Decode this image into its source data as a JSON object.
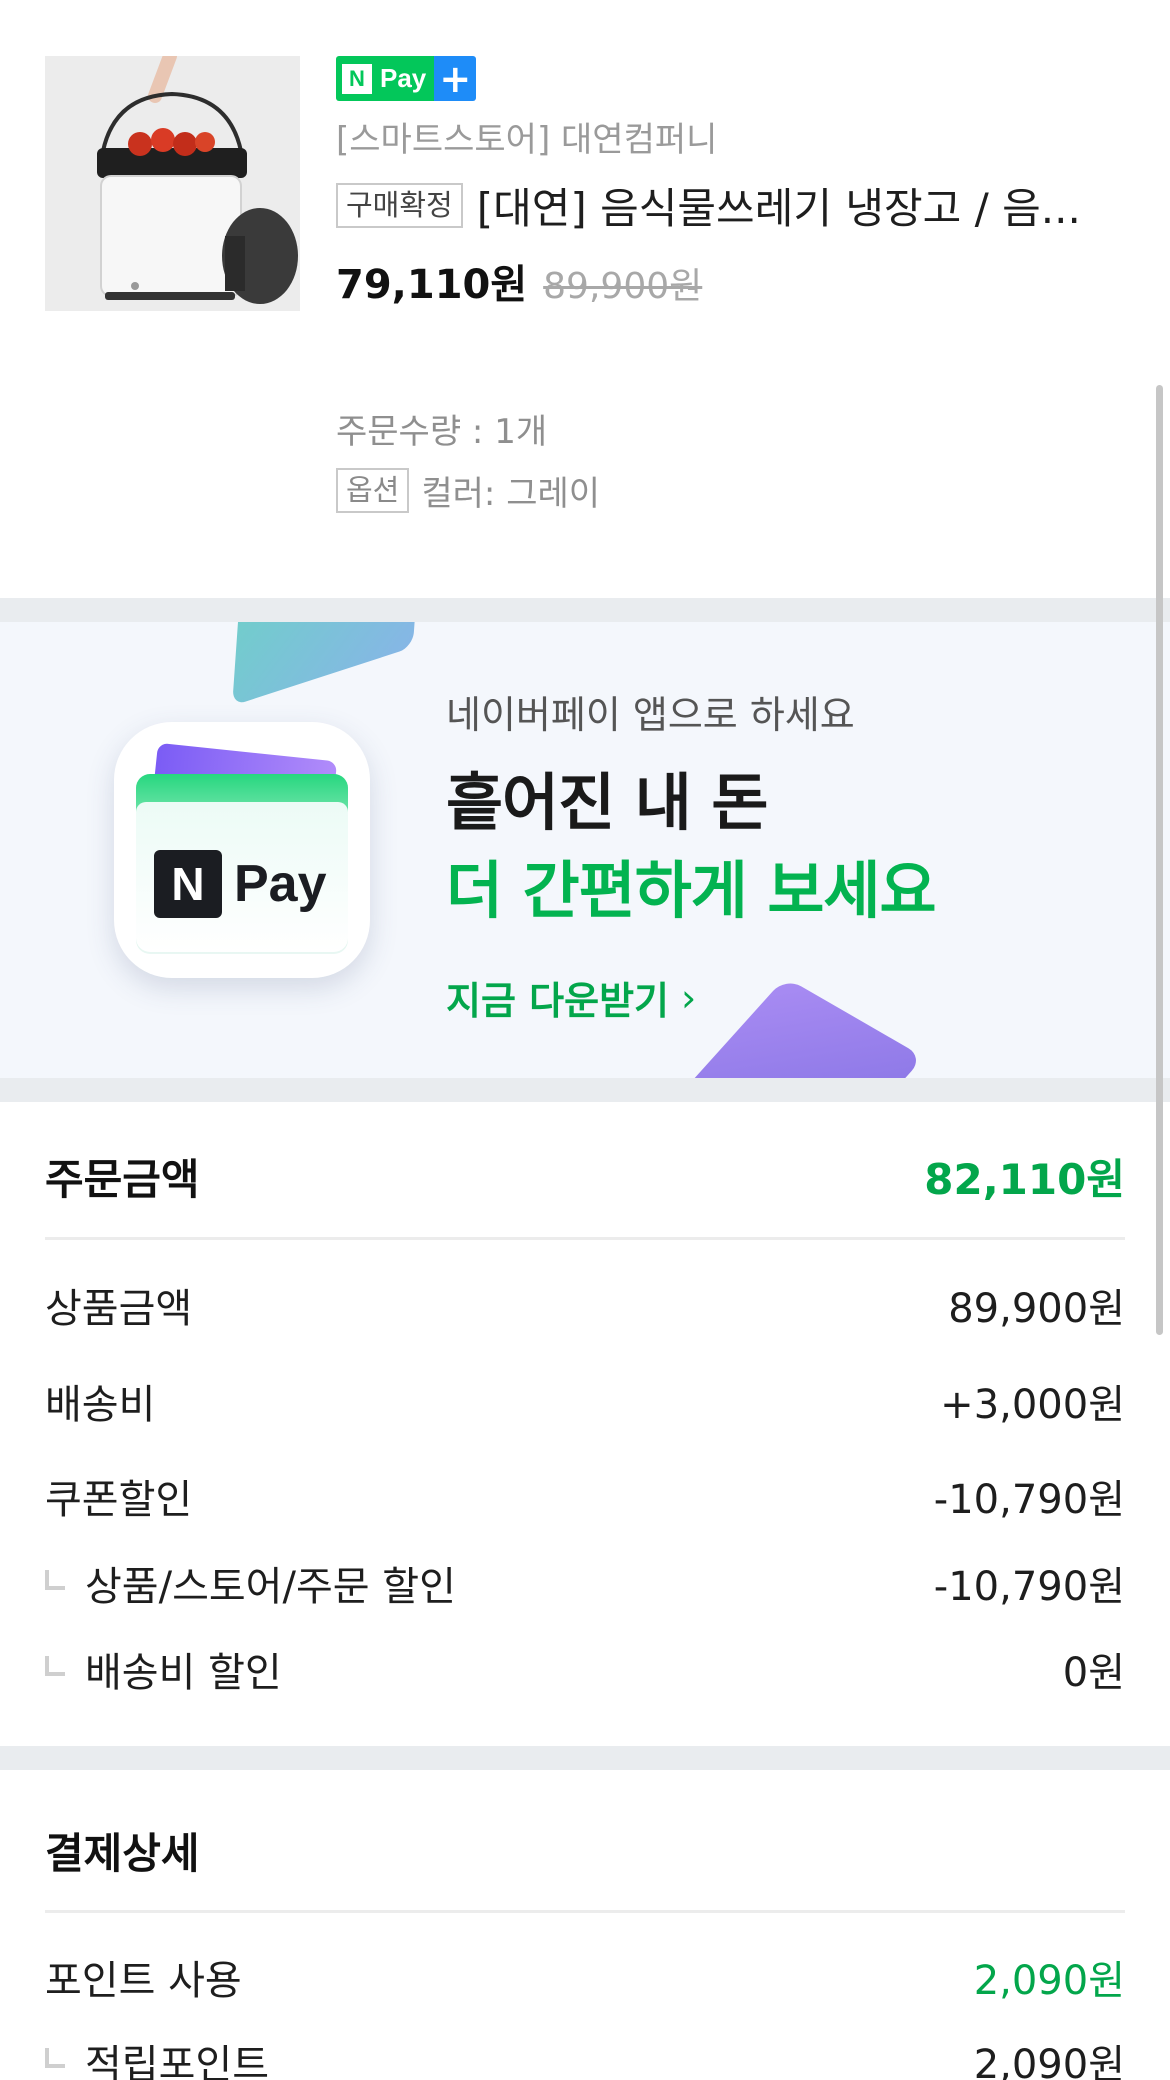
{
  "product": {
    "badge": {
      "n": "N",
      "pay": "Pay",
      "plus": "+"
    },
    "store": "[스마트스토어] 대연컴퍼니",
    "status": "구매확정",
    "title": "[대연] 음식물쓰레기 냉장고 / 음...",
    "price": "79,110원",
    "original_price": "89,900원",
    "quantity": "주문수량 : 1개",
    "option_tag": "옵션",
    "option_value": "컬러: 그레이"
  },
  "banner": {
    "subtitle": "네이버페이 앱으로 하세요",
    "line1": "흩어진 내 돈",
    "line2": "더 간편하게 보세요",
    "cta": "지금 다운받기",
    "cta_chevron": "›",
    "icon_n": "N",
    "icon_pay": "Pay"
  },
  "order_summary": {
    "title": "주문금액",
    "total": "82,110원",
    "rows": [
      {
        "label": "상품금액",
        "value": "89,900원"
      },
      {
        "label": "배송비",
        "value": "+3,000원"
      },
      {
        "label": "쿠폰할인",
        "value": "-10,790원"
      },
      {
        "label": "상품/스토어/주문 할인",
        "value": "-10,790원"
      },
      {
        "label": "배송비 할인",
        "value": "0원"
      }
    ]
  },
  "payment_detail": {
    "title": "결제상세",
    "rows": [
      {
        "label": "포인트 사용",
        "value": "2,090원"
      },
      {
        "label": "적립포인트",
        "value": "2,090원"
      }
    ]
  },
  "colors": {
    "brand_green": "#03c75a",
    "amount_green": "#03a64b",
    "plus_blue": "#1e8cf8"
  }
}
